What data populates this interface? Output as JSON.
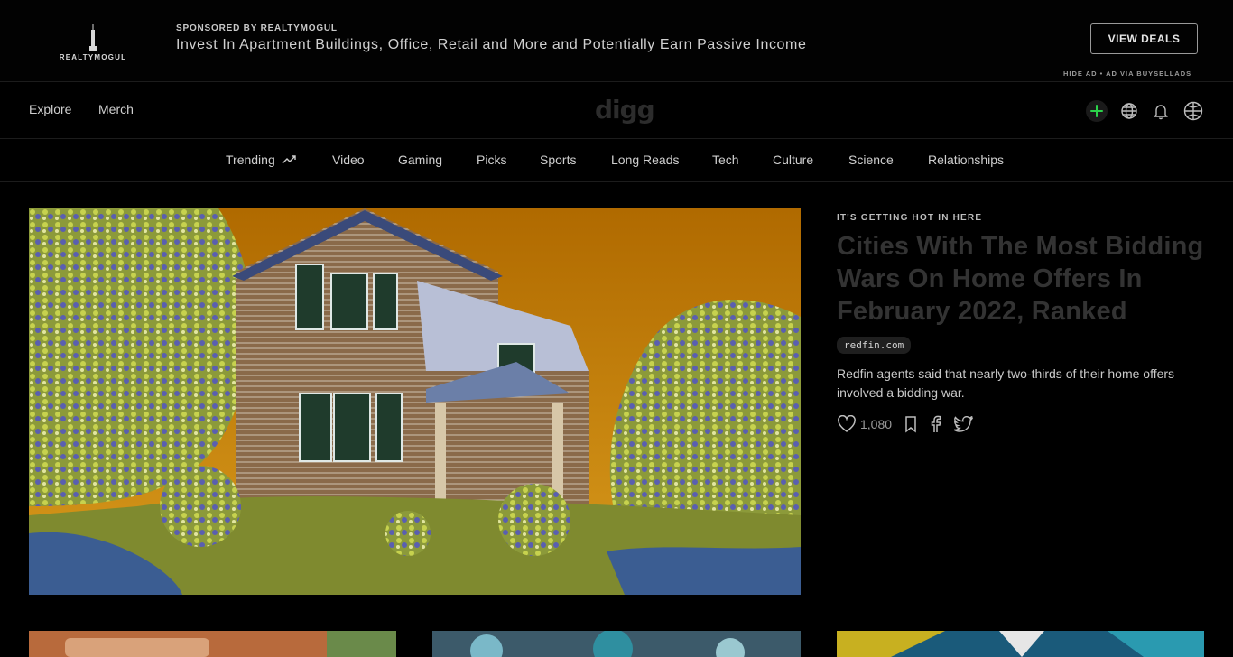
{
  "ad": {
    "logo_text": "REALTYMOGUL",
    "sponsor_label": "SPONSORED BY REALTYMOGUL",
    "headline": "Invest In Apartment Buildings, Office, Retail and More and Potentially Earn Passive Income",
    "cta_label": "VIEW DEALS",
    "hide_label": "HIDE AD • AD VIA BUYSELLADS"
  },
  "header": {
    "explore_label": "Explore",
    "merch_label": "Merch",
    "logo": "digg",
    "icons": [
      "plus-icon",
      "globe-icon",
      "bell-icon",
      "user-icon"
    ]
  },
  "categories": [
    "Trending",
    "Video",
    "Gaming",
    "Picks",
    "Sports",
    "Long Reads",
    "Tech",
    "Culture",
    "Science",
    "Relationships"
  ],
  "hero": {
    "kicker": "IT'S GETTING HOT IN HERE",
    "headline": "Cities With The Most Bidding Wars On Home Offers In February 2022, Ranked",
    "source": "redfin.com",
    "description": "Redfin agents said that nearly two-thirds of their home offers involved a bidding war.",
    "like_count": "1,080",
    "image_alt": "house"
  },
  "colors": {
    "background": "#000000",
    "accent_green": "#2bd34a",
    "headline_text": "#333333"
  }
}
